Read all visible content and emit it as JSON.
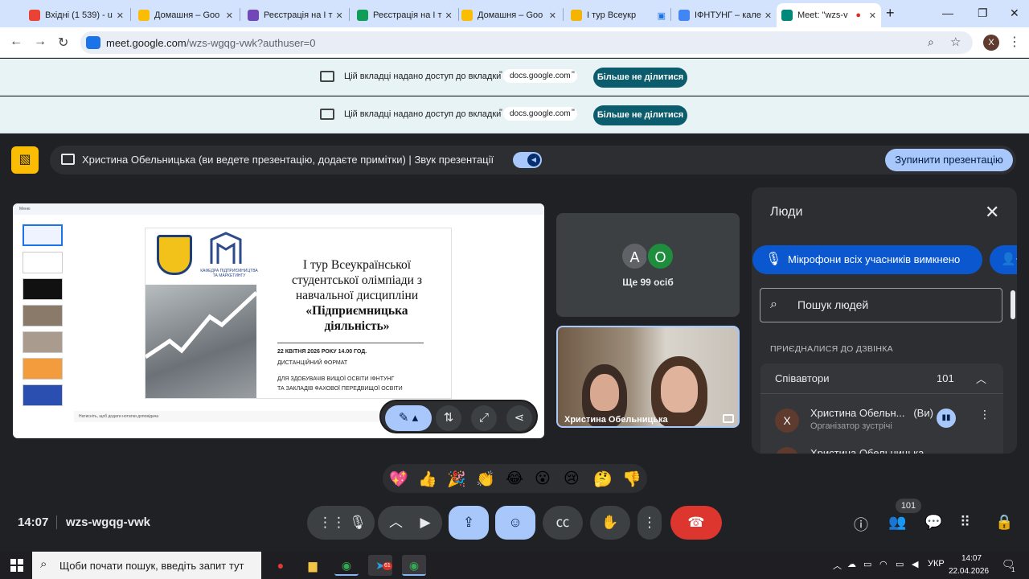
{
  "browser": {
    "tabs": [
      {
        "label": "Вхідні (1 539) - u",
        "color": "#ea4335"
      },
      {
        "label": "Домашня – Goo",
        "color": "#fbbc04"
      },
      {
        "label": "Реєстрація на І т",
        "color": "#7248b9"
      },
      {
        "label": "Реєстрація на І т",
        "color": "#0f9d58"
      },
      {
        "label": "Домашня – Goo",
        "color": "#fbbc04"
      },
      {
        "label": "І тур Всеукр",
        "color": "#f4b400"
      },
      {
        "label": "ІФНТУНГ – кале",
        "color": "#4285f4"
      },
      {
        "label": "Meet: \"wzs-v",
        "color": "#00897b"
      }
    ],
    "new_tab": "+",
    "url_host": "meet.google.com",
    "url_path": "/wzs-wgqg-vwk?authuser=0",
    "profile_initial": "X"
  },
  "share_banner": {
    "text": "Цій вкладці надано доступ до вкладки",
    "quote_open": "\"",
    "quote_close": "\"",
    "domain": "docs.google.com",
    "stop_label": "Більше не ділитися"
  },
  "meet": {
    "presenting_text": "Христина Обельницька (ви ведете презентацію, додаєте примітки)",
    "divider": "|",
    "sound_label": "Звук презентації",
    "stop_presenting": "Зупинити презентацію",
    "slide": {
      "menu": "Меню",
      "logo_caption_1": "КАФЕДРА ПІДПРИЄМНИЦТВА",
      "logo_caption_2": "ТА МАРКЕТИНГУ",
      "title_1": "І тур Всеукраїнської",
      "title_2": "студентської олімпіади з",
      "title_3": "навчальної дисципліни",
      "title_4": "«Підприємницька",
      "title_5": "діяльність»",
      "date": "22 КВІТНЯ 2026 РОКУ 14.00 ГОД.",
      "format": "ДИСТАНЦІЙНИЙ ФОРМАТ",
      "line1": "ДЛЯ ЗДОБУВАЧІВ ВИЩОЇ ОСВІТИ ІФНТУНГ",
      "line2": "ТА ЗАКЛАДІВ ФАХОВОЇ ПЕРЕДВИЩОЇ ОСВІТИ",
      "notes_placeholder": "Натисніть, щоб додати нотатки доповідача"
    },
    "others_avatars": [
      "A",
      "O"
    ],
    "others_count": "Ще 99 осіб",
    "video_name": "Христина Обельницька",
    "people": {
      "title": "Люди",
      "mute_all": "Мікрофони всіх учасників вимкнено",
      "search_placeholder": "Пошук людей",
      "joined_heading": "ПРИЄДНАЛИСЯ ДО ДЗВІНКА",
      "group_name": "Співавтори",
      "group_count": "101",
      "member_initial": "Х",
      "member_name": "Христина Обельн...",
      "member_you": "(Ви)",
      "member_role": "Організатор зустрічі",
      "member2_name": "Христина Обельницька"
    },
    "reactions": [
      "💖",
      "👍",
      "🎉",
      "👏",
      "😂",
      "😮",
      "😢",
      "🤔",
      "👎"
    ],
    "time": "14:07",
    "meeting_code": "wzs-wgqg-vwk",
    "people_badge": "101"
  },
  "taskbar": {
    "search_placeholder": "Щоби почати пошук, введіть запит тут",
    "telegram_badge": "61",
    "lang": "УКР",
    "time": "14:07",
    "date": "22.04.2026",
    "notif_count": "1"
  }
}
